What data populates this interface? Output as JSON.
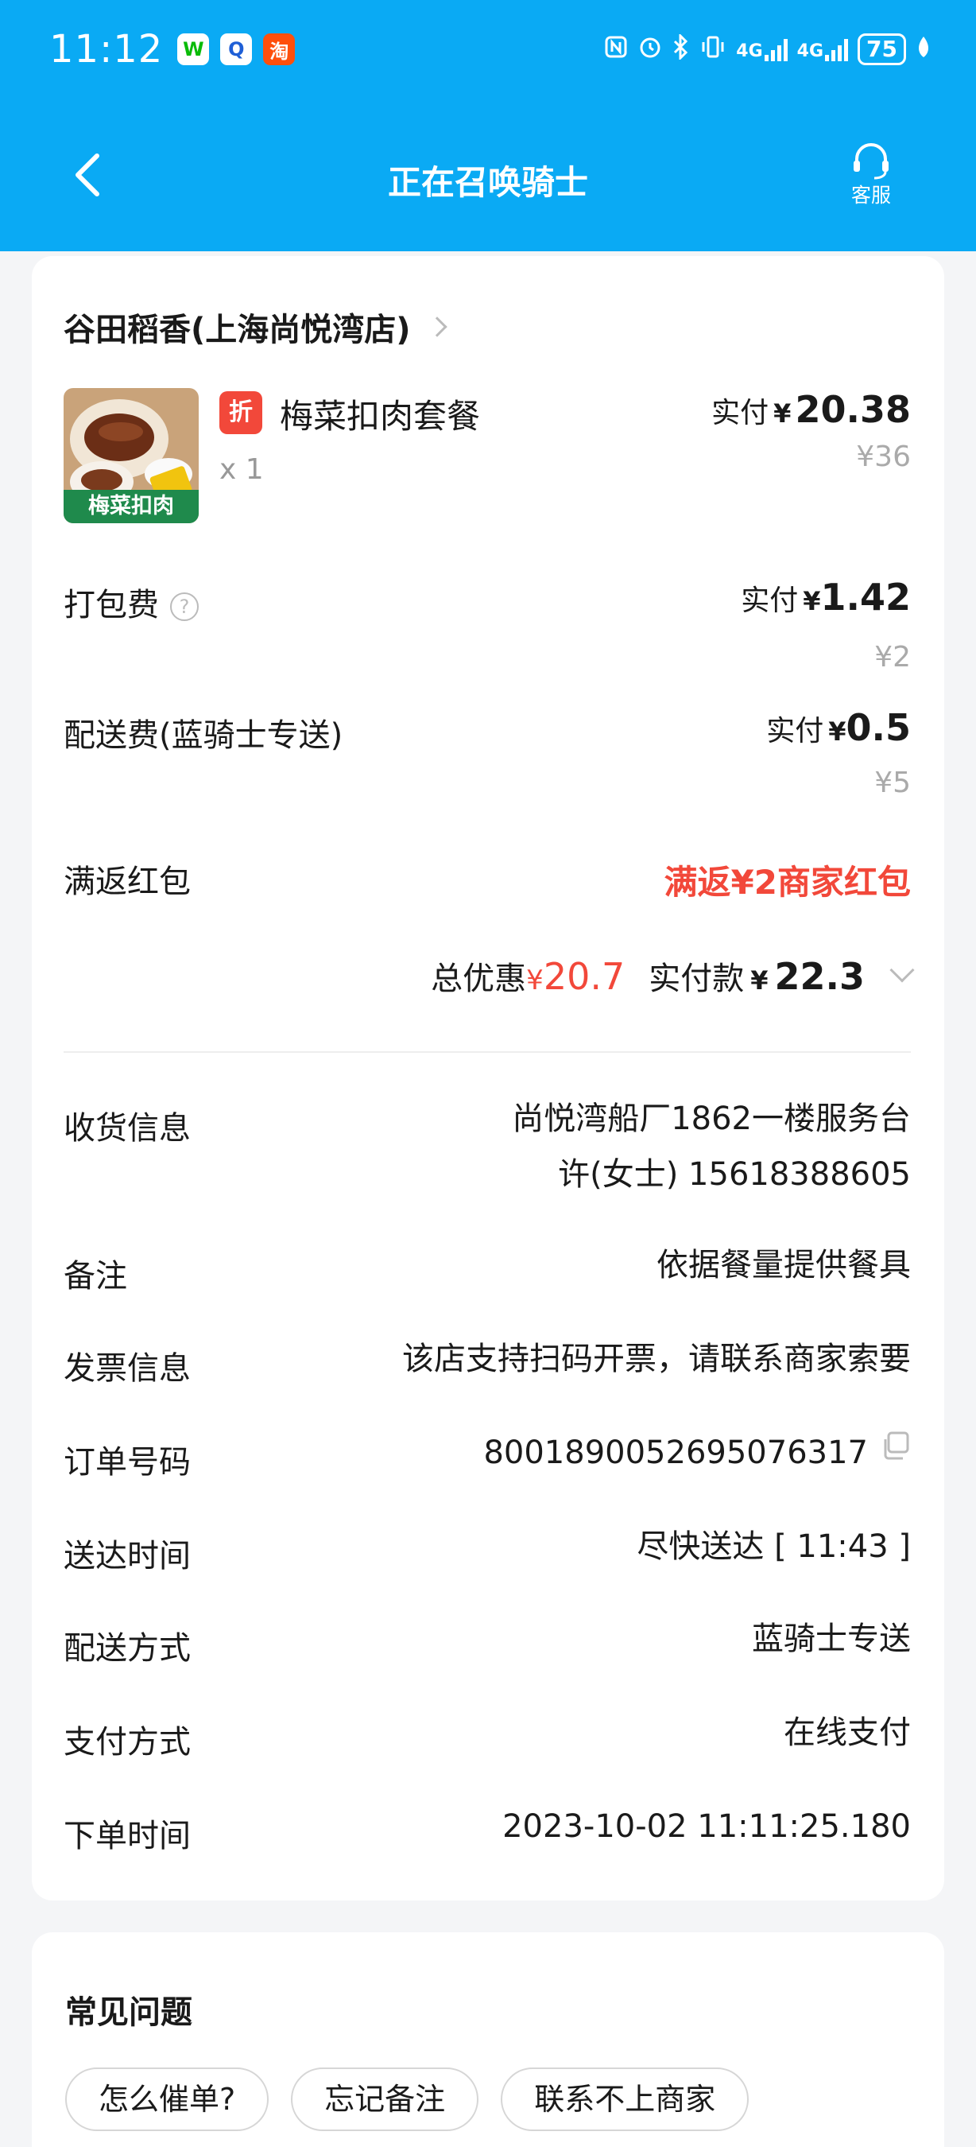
{
  "status_bar": {
    "time": "11:12",
    "battery": "75",
    "signal_1": "4G",
    "signal_2": "4G",
    "apps": [
      {
        "name": "wechat-icon",
        "glyph": "W"
      },
      {
        "name": "qq-icon",
        "glyph": "Q"
      },
      {
        "name": "taobao-icon",
        "glyph": "淘"
      }
    ]
  },
  "header": {
    "title": "正在召唤骑士",
    "service_label": "客服"
  },
  "order": {
    "shop_name": "谷田稻香(上海尚悦湾店)",
    "item": {
      "badge": "折",
      "name": "梅菜扣肉套餐",
      "quantity": "x 1",
      "image_caption": "梅菜扣肉",
      "paid_prefix": "实付",
      "paid_currency": "¥",
      "paid_amount": "20.38",
      "original_price": "¥36"
    },
    "packaging": {
      "label": "打包费",
      "help": "?",
      "paid_prefix": "实付",
      "paid_currency": "¥",
      "paid_amount": "1.42",
      "original_price": "¥2"
    },
    "delivery_fee": {
      "label": "配送费(蓝骑士专送)",
      "paid_prefix": "实付",
      "paid_currency": "¥",
      "paid_amount": "0.5",
      "original_price": "¥5"
    },
    "red_packet": {
      "label": "满返红包",
      "value": "满返¥2商家红包"
    },
    "summary": {
      "discount_label": "总优惠",
      "discount_currency": "¥",
      "discount_amount": "20.7",
      "paid_label": "实付款",
      "paid_currency": "¥",
      "paid_amount": "22.3"
    }
  },
  "details": {
    "address_label": "收货信息",
    "address_line1": "尚悦湾船厂1862一楼服务台",
    "address_line2": "许(女士) 15618388605",
    "note_label": "备注",
    "note_value": "依据餐量提供餐具",
    "invoice_label": "发票信息",
    "invoice_value": "该店支持扫码开票，请联系商家索要",
    "order_no_label": "订单号码",
    "order_no_value": "8001890052695076317",
    "eta_label": "送达时间",
    "eta_value": "尽快送达 [ 11:43 ]",
    "delivery_method_label": "配送方式",
    "delivery_method_value": "蓝骑士专送",
    "payment_label": "支付方式",
    "payment_value": "在线支付",
    "order_time_label": "下单时间",
    "order_time_value": "2023-10-02 11:11:25.180"
  },
  "faq": {
    "title": "常见问题",
    "chips": [
      "怎么催单?",
      "忘记备注",
      "联系不上商家"
    ]
  },
  "colors": {
    "header_bg": "#0aaaf4",
    "accent_red": "#f2483a",
    "page_bg": "#f4f5f7"
  }
}
